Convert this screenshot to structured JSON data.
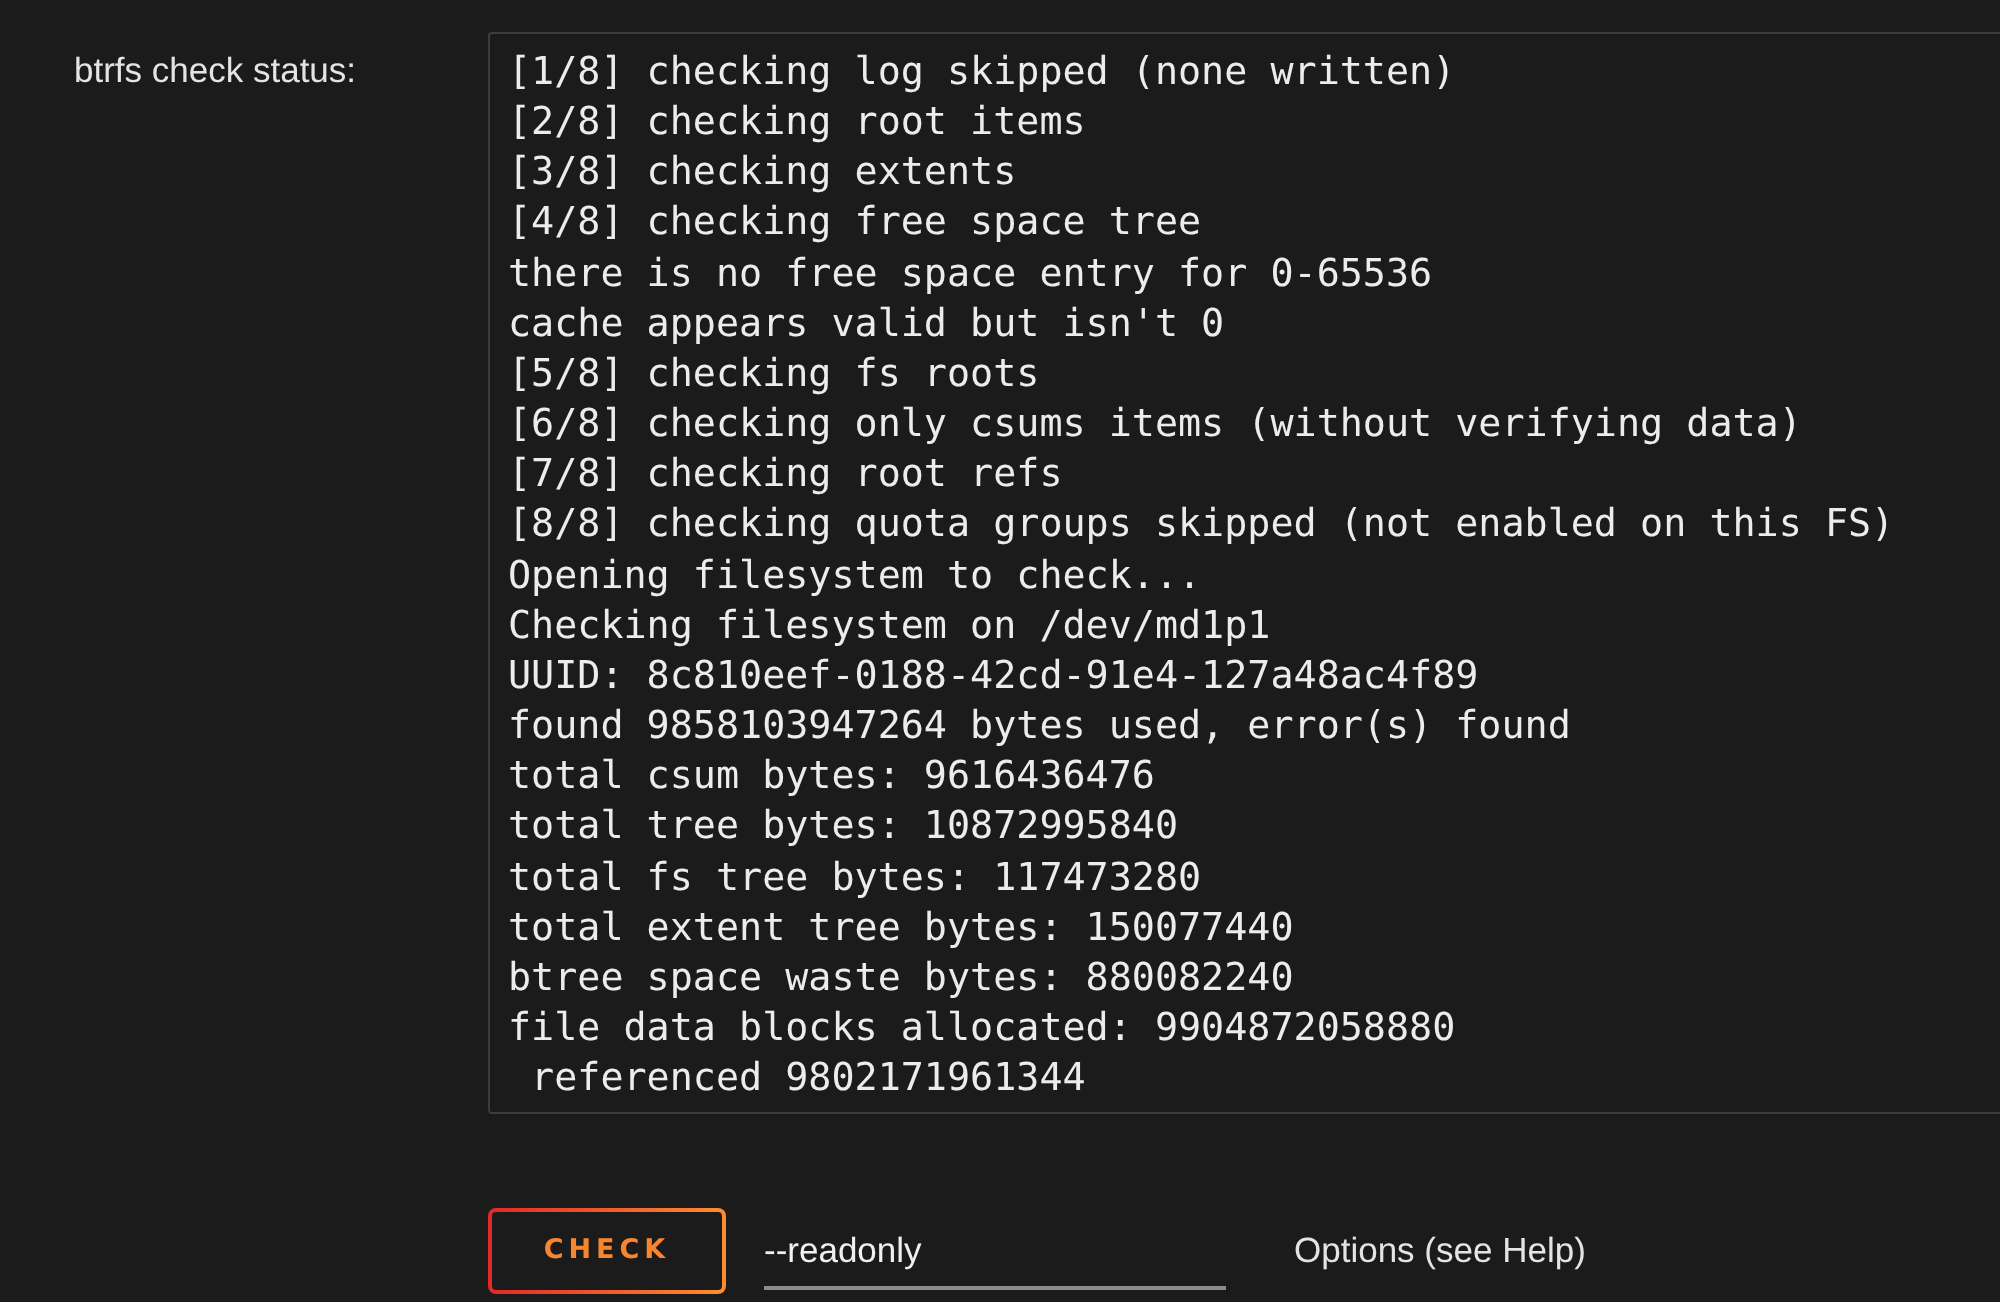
{
  "status": {
    "label": "btrfs check status:",
    "log_lines": [
      "[1/8] checking log skipped (none written)",
      "[2/8] checking root items",
      "[3/8] checking extents",
      "[4/8] checking free space tree",
      "there is no free space entry for 0-65536",
      "cache appears valid but isn't 0",
      "[5/8] checking fs roots",
      "[6/8] checking only csums items (without verifying data)",
      "[7/8] checking root refs",
      "[8/8] checking quota groups skipped (not enabled on this FS)",
      "Opening filesystem to check...",
      "Checking filesystem on /dev/md1p1",
      "UUID: 8c810eef-0188-42cd-91e4-127a48ac4f89",
      "found 9858103947264 bytes used, error(s) found",
      "total csum bytes: 9616436476",
      "total tree bytes: 10872995840",
      "total fs tree bytes: 117473280",
      "total extent tree bytes: 150077440",
      "btree space waste bytes: 880082240",
      "file data blocks allocated: 9904872058880",
      " referenced 9802171961344"
    ]
  },
  "actions": {
    "button": "CHECK",
    "options_field": {
      "value": "--readonly"
    },
    "hint": "Options (see Help)"
  }
}
